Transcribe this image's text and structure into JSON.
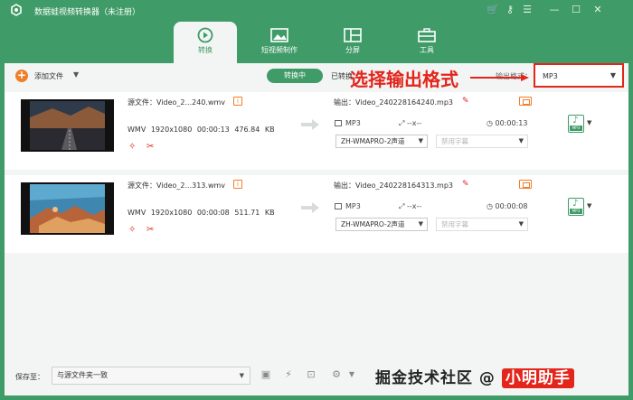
{
  "app": {
    "title": "数据蛙视频转换器（未注册）"
  },
  "tabs": [
    {
      "label": "转换"
    },
    {
      "label": "短视频制作"
    },
    {
      "label": "分屏"
    },
    {
      "label": "工具"
    }
  ],
  "toolbar": {
    "add_label": "添加文件",
    "converting_label": "转换中",
    "converted_label": "已转换",
    "output_format_label": "输出格式：",
    "output_format_value": "MP3",
    "annotation": "选择输出格式"
  },
  "files": [
    {
      "source": "源文件：Video_2...240.wmv",
      "format": "WMV",
      "resolution": "1920x1080",
      "duration": "00:00:13",
      "size": "476.84 KB",
      "output": "输出：Video_240228164240.mp3",
      "out_format": "MP3",
      "out_res": "--x--",
      "out_duration": "00:00:13",
      "audio_track": "ZH-WMAPRO-2声道",
      "subtitle": "禁用字幕",
      "badge": "MP3"
    },
    {
      "source": "源文件：Video_2...313.wmv",
      "format": "WMV",
      "resolution": "1920x1080",
      "duration": "00:00:08",
      "size": "511.71 KB",
      "output": "输出：Video_240228164313.mp3",
      "out_format": "MP3",
      "out_res": "--x--",
      "out_duration": "00:00:08",
      "audio_track": "ZH-WMAPRO-2声道",
      "subtitle": "禁用字幕",
      "badge": "MP3"
    }
  ],
  "footer": {
    "save_label": "保存至：",
    "save_path": "与源文件夹一致",
    "watermark_text": "掘金技术社区 @",
    "watermark_name": "小明助手"
  },
  "colors": {
    "brand": "#3f9b67",
    "accent": "#f07f2b",
    "annotation": "#e3251c"
  }
}
